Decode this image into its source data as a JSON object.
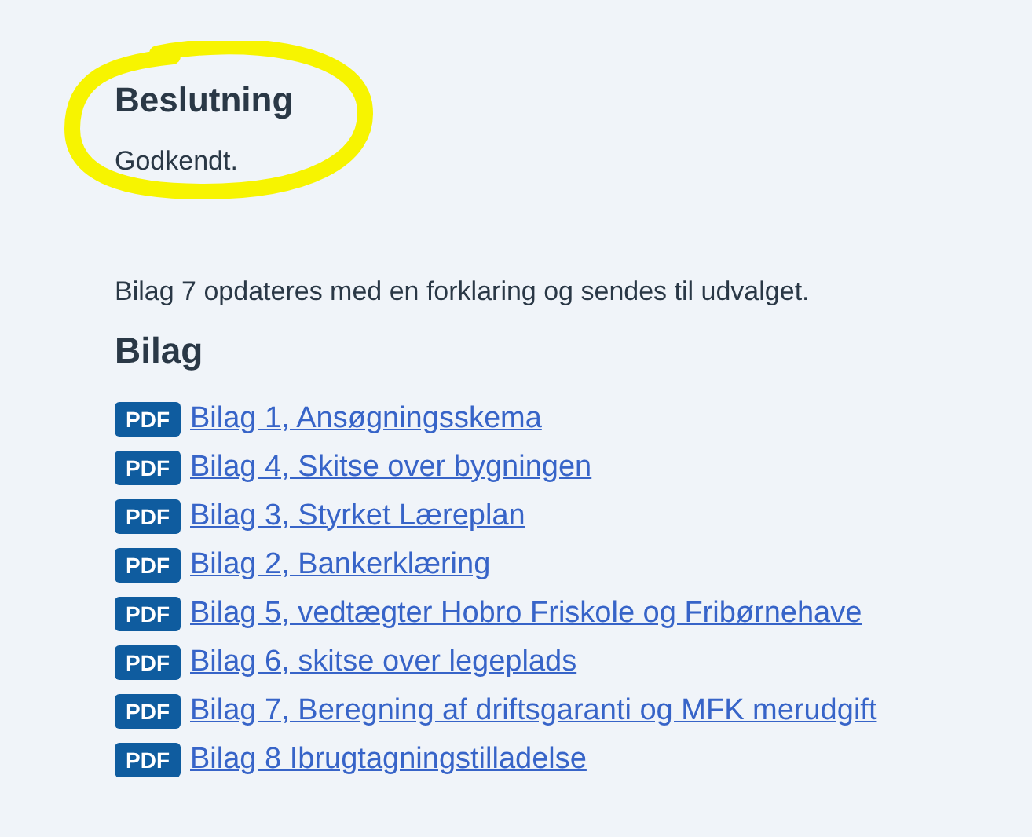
{
  "decision": {
    "heading": "Beslutning",
    "text": "Godkendt."
  },
  "note": "Bilag 7 opdateres med en forklaring og sendes til udvalget.",
  "attachments": {
    "heading": "Bilag",
    "items": [
      {
        "badge": "PDF",
        "label": "Bilag 1, Ansøgningsskema"
      },
      {
        "badge": "PDF",
        "label": "Bilag 4, Skitse over bygningen"
      },
      {
        "badge": "PDF",
        "label": "Bilag 3, Styrket Læreplan"
      },
      {
        "badge": "PDF",
        "label": "Bilag 2, Bankerklæring"
      },
      {
        "badge": "PDF",
        "label": "Bilag 5, vedtægter Hobro Friskole og Fribørnehave"
      },
      {
        "badge": "PDF",
        "label": "Bilag 6, skitse over legeplads"
      },
      {
        "badge": "PDF",
        "label": "Bilag 7, Beregning af driftsgaranti og MFK merudgift"
      },
      {
        "badge": "PDF",
        "label": "Bilag 8 Ibrugtagningstilladelse"
      }
    ]
  }
}
